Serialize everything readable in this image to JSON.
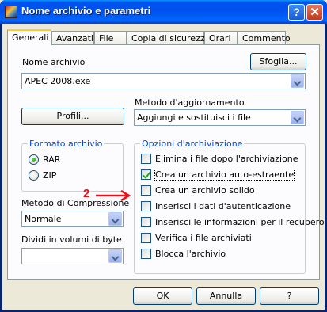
{
  "window": {
    "title": "Nome archivio e parametri",
    "help_glyph": "?",
    "close_glyph": "✕"
  },
  "tabs": [
    {
      "label": "Generali",
      "active": true
    },
    {
      "label": "Avanzati"
    },
    {
      "label": "File"
    },
    {
      "label": "Copia di sicurezza"
    },
    {
      "label": "Orari"
    },
    {
      "label": "Commento"
    }
  ],
  "archive_name": {
    "label": "Nome archivio",
    "browse_label": "Sfoglia...",
    "value": "APEC 2008.exe"
  },
  "profiles_label": "Profili...",
  "update_method": {
    "label": "Metodo d'aggiornamento",
    "value": "Aggiungi e sostituisci i file"
  },
  "archive_format": {
    "title": "Formato archivio",
    "options": [
      {
        "label": "RAR",
        "checked": true
      },
      {
        "label": "ZIP",
        "checked": false
      }
    ]
  },
  "compression": {
    "label": "Metodo di Compressione",
    "value": "Normale"
  },
  "split_volumes": {
    "label": "Dividi in volumi di byte",
    "value": ""
  },
  "archive_options": {
    "title": "Opzioni d'archiviazione",
    "items": [
      {
        "label": "Elimina i file dopo l'archiviazione",
        "checked": false
      },
      {
        "label": "Crea un archivio auto-estraente",
        "checked": true
      },
      {
        "label": "Crea un archivio solido",
        "checked": false
      },
      {
        "label": "Inserisci i dati d'autenticazione",
        "checked": false
      },
      {
        "label": "Inserisci le informazioni per il recupero",
        "checked": false
      },
      {
        "label": "Verifica i file archiviati",
        "checked": false
      },
      {
        "label": "Blocca l'archivio",
        "checked": false
      }
    ]
  },
  "annotation": {
    "number": "2",
    "color": "#e8101a"
  },
  "buttons": {
    "ok": "OK",
    "cancel": "Annulla",
    "help": "?"
  }
}
